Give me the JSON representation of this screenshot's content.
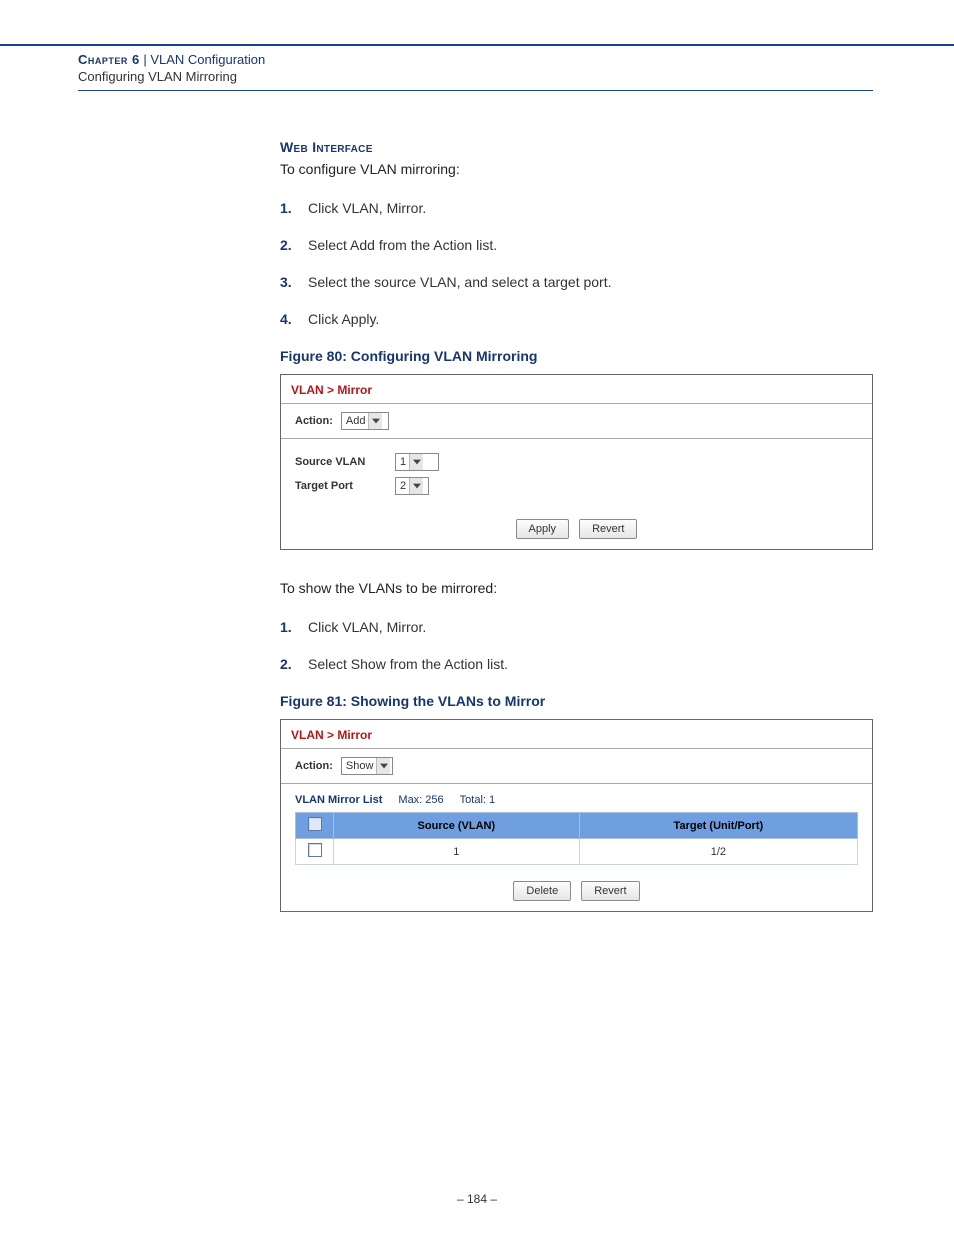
{
  "header": {
    "chapter_label": "Chapter 6",
    "divider": "  |  ",
    "chapter_title": "VLAN Configuration",
    "subtitle": "Configuring VLAN Mirroring"
  },
  "section": {
    "web_interface": "Web Interface",
    "intro1": "To configure VLAN mirroring:",
    "steps1": [
      "Click VLAN, Mirror.",
      "Select Add from the Action list.",
      "Select the source VLAN, and select a target port.",
      "Click Apply."
    ],
    "fig80_caption": "Figure 80:  Configuring VLAN Mirroring",
    "intro2": "To show the VLANs to be mirrored:",
    "steps2": [
      "Click VLAN, Mirror.",
      "Select Show from the Action list."
    ],
    "fig81_caption": "Figure 81:  Showing the VLANs to Mirror"
  },
  "fig80": {
    "breadcrumb": "VLAN > Mirror",
    "action_label": "Action:",
    "action_value": "Add",
    "source_vlan_label": "Source VLAN",
    "source_vlan_value": "1",
    "target_port_label": "Target Port",
    "target_port_value": "2",
    "apply": "Apply",
    "revert": "Revert"
  },
  "fig81": {
    "breadcrumb": "VLAN > Mirror",
    "action_label": "Action:",
    "action_value": "Show",
    "list_label": "VLAN Mirror List",
    "max_label": "Max: 256",
    "total_label": "Total: 1",
    "col_source": "Source (VLAN)",
    "col_target": "Target (Unit/Port)",
    "rows": [
      {
        "source": "1",
        "target": "1/2"
      }
    ],
    "delete": "Delete",
    "revert": "Revert"
  },
  "footer": {
    "page": "–  184  –"
  }
}
